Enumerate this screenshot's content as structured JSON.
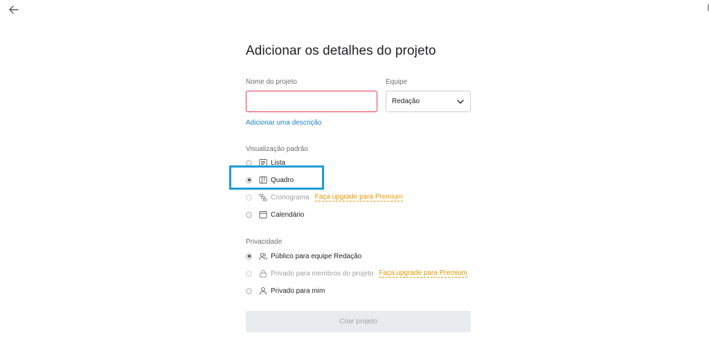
{
  "header": {
    "back_icon": "arrow-left-icon"
  },
  "form": {
    "title": "Adicionar os detalhes do projeto",
    "project_name_label": "Nome do projeto",
    "project_name_value": "",
    "team_label": "Equipe",
    "team_value": "Redação",
    "add_description_link": "Adicionar uma descrição"
  },
  "default_view": {
    "label": "Visualização padrão",
    "options": [
      {
        "label": "Lista",
        "icon": "list-icon",
        "checked": false,
        "disabled": false
      },
      {
        "label": "Quadro",
        "icon": "board-icon",
        "checked": true,
        "disabled": false
      },
      {
        "label": "Cronograma",
        "icon": "timeline-icon",
        "checked": false,
        "disabled": true,
        "upgrade": "Faça upgrade para Premium"
      },
      {
        "label": "Calendário",
        "icon": "calendar-icon",
        "checked": false,
        "disabled": false
      }
    ]
  },
  "privacy": {
    "label": "Privacidade",
    "options": [
      {
        "label": "Público para equipe Redação",
        "icon": "team-icon",
        "checked": true,
        "disabled": false
      },
      {
        "label": "Privado para membros do projeto",
        "icon": "lock-icon",
        "checked": false,
        "disabled": true,
        "upgrade": "Faça upgrade para Premium"
      },
      {
        "label": "Privado para mim",
        "icon": "person-icon",
        "checked": false,
        "disabled": false
      }
    ]
  },
  "create_button": "Criar projeto",
  "colors": {
    "accent_link": "#1b84c7",
    "upgrade": "#e69a00",
    "error_border": "#e8384f",
    "highlight": "#1e9bd7"
  }
}
